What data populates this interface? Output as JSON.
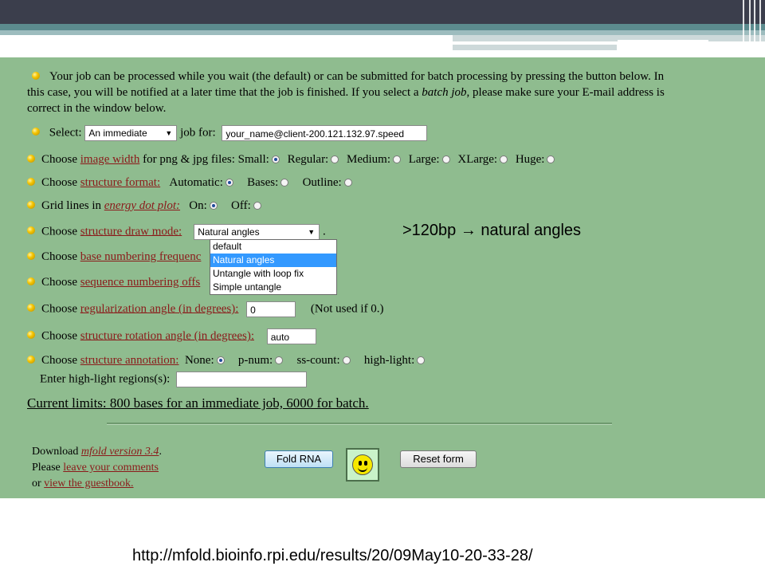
{
  "intro": {
    "text_before": "Your job can be processed while you wait (the default) or can be submitted for batch processing by pressing the button below. In this case, you will be notified at a later time that the job is finished. If you select a ",
    "batch_job": "batch job",
    "text_after": ", please make sure your E-mail address is correct in the window below."
  },
  "select_row": {
    "label": "Select:",
    "select_value": "An immediate",
    "job_for": "job for:",
    "email": "your_name@client-200.121.132.97.speed"
  },
  "image_width": {
    "choose": "Choose",
    "link": "image width",
    "after": "for png & jpg files:",
    "options": [
      "Small:",
      "Regular:",
      "Medium:",
      "Large:",
      "XLarge:",
      "Huge:"
    ],
    "selected": "Small:"
  },
  "structure_format": {
    "choose": "Choose",
    "link": "structure format:",
    "options": [
      "Automatic:",
      "Bases:",
      "Outline:"
    ],
    "selected": "Automatic:"
  },
  "grid_lines": {
    "label": "Grid lines in",
    "link": "energy dot plot:",
    "options": [
      "On:",
      "Off:"
    ],
    "selected": "On:"
  },
  "draw_mode": {
    "choose": "Choose",
    "link": "structure draw mode:",
    "select_value": "Natural angles",
    "period": ".",
    "dropdown_options": [
      "default",
      "Natural angles",
      "Untangle with loop fix",
      "Simple untangle"
    ],
    "highlighted": "Natural angles"
  },
  "annotation_note": ">120bp  → natural angles",
  "base_numbering": {
    "choose": "Choose",
    "link": "base numbering frequenc"
  },
  "seq_numbering": {
    "choose": "Choose",
    "link": "sequence numbering offs"
  },
  "regularization": {
    "choose": "Choose",
    "link": "regularization angle (in degrees):",
    "value": "0",
    "note": "(Not used if 0.)"
  },
  "rotation": {
    "choose": "Choose",
    "link": "structure rotation angle (in degrees):",
    "value": "auto"
  },
  "annotation": {
    "choose": "Choose",
    "link": "structure annotation:",
    "options": [
      "None:",
      "p-num:",
      "ss-count:",
      "high-light:"
    ],
    "selected": "None:",
    "highlight_label": "Enter high-light regions(s):",
    "highlight_value": ""
  },
  "limits": "Current limits: 800 bases for an immediate job, 6000 for batch.",
  "footer": {
    "download": "Download",
    "mfold_link": "mfold version 3.4",
    "period": ".",
    "please": "Please",
    "comments_link": "leave your comments",
    "or": "or",
    "guestbook_link": "view the guestbook."
  },
  "buttons": {
    "fold": "Fold RNA",
    "reset": "Reset form"
  },
  "url": "http://mfold.bioinfo.rpi.edu/results/20/09May10-20-33-28/",
  "colors": {
    "form_bg": "#8fbc8f",
    "link": "#8b1a1a",
    "header_dark": "#3b3e4c",
    "teal": "#5c8b8e",
    "highlight": "#3399ff"
  }
}
